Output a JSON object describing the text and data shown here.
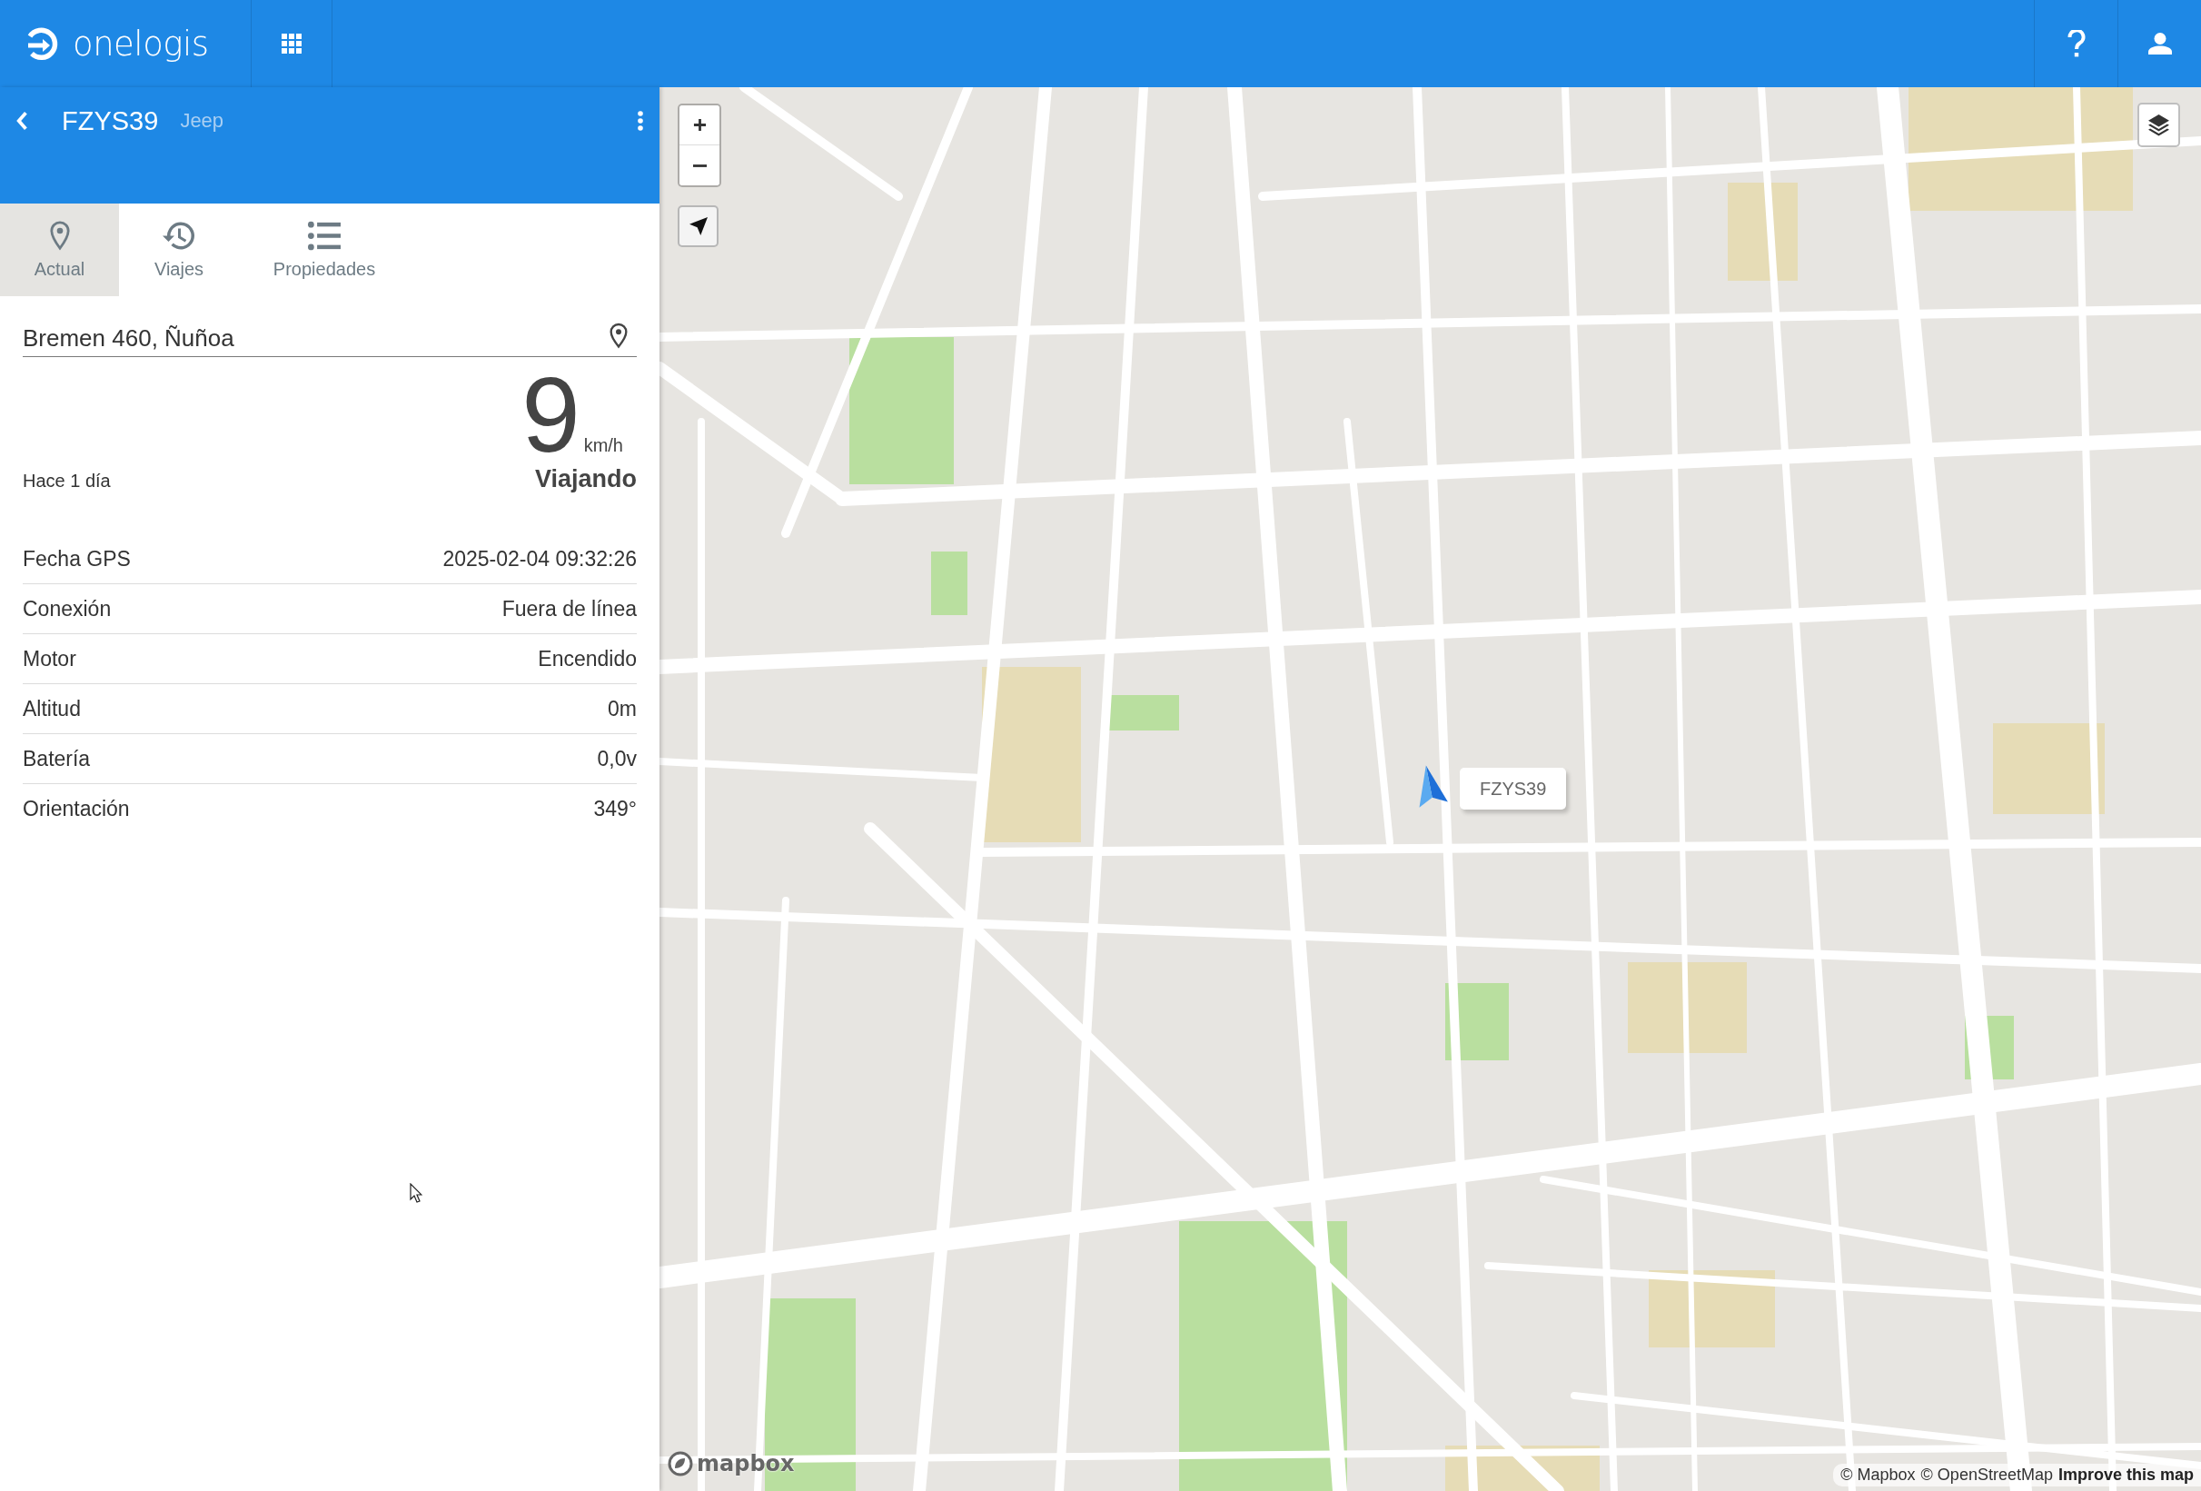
{
  "app_bar": {
    "brand": "onelogis"
  },
  "vehicle": {
    "plate": "FZYS39",
    "model": "Jeep"
  },
  "tabs": [
    {
      "label": "Actual",
      "selected": true
    },
    {
      "label": "Viajes",
      "selected": false
    },
    {
      "label": "Propiedades",
      "selected": false
    }
  ],
  "address": {
    "value": "Bremen 460, Ñuñoa"
  },
  "status": {
    "last_update": "Hace 1 día",
    "speed": "9",
    "speed_unit": "km/h",
    "state": "Viajando"
  },
  "properties": [
    {
      "label": "Fecha GPS",
      "value": "2025-02-04 09:32:26"
    },
    {
      "label": "Conexión",
      "value": "Fuera de línea"
    },
    {
      "label": "Motor",
      "value": "Encendido"
    },
    {
      "label": "Altitud",
      "value": "0m"
    },
    {
      "label": "Batería",
      "value": "0,0v"
    },
    {
      "label": "Orientación",
      "value": "349°"
    }
  ],
  "map": {
    "vehicle_label": "FZYS39",
    "logo": "mapbox",
    "attribution": [
      {
        "text": "© Mapbox",
        "bold": false
      },
      {
        "text": "© OpenStreetMap",
        "bold": false
      },
      {
        "text": "Improve this map",
        "bold": true
      }
    ]
  }
}
